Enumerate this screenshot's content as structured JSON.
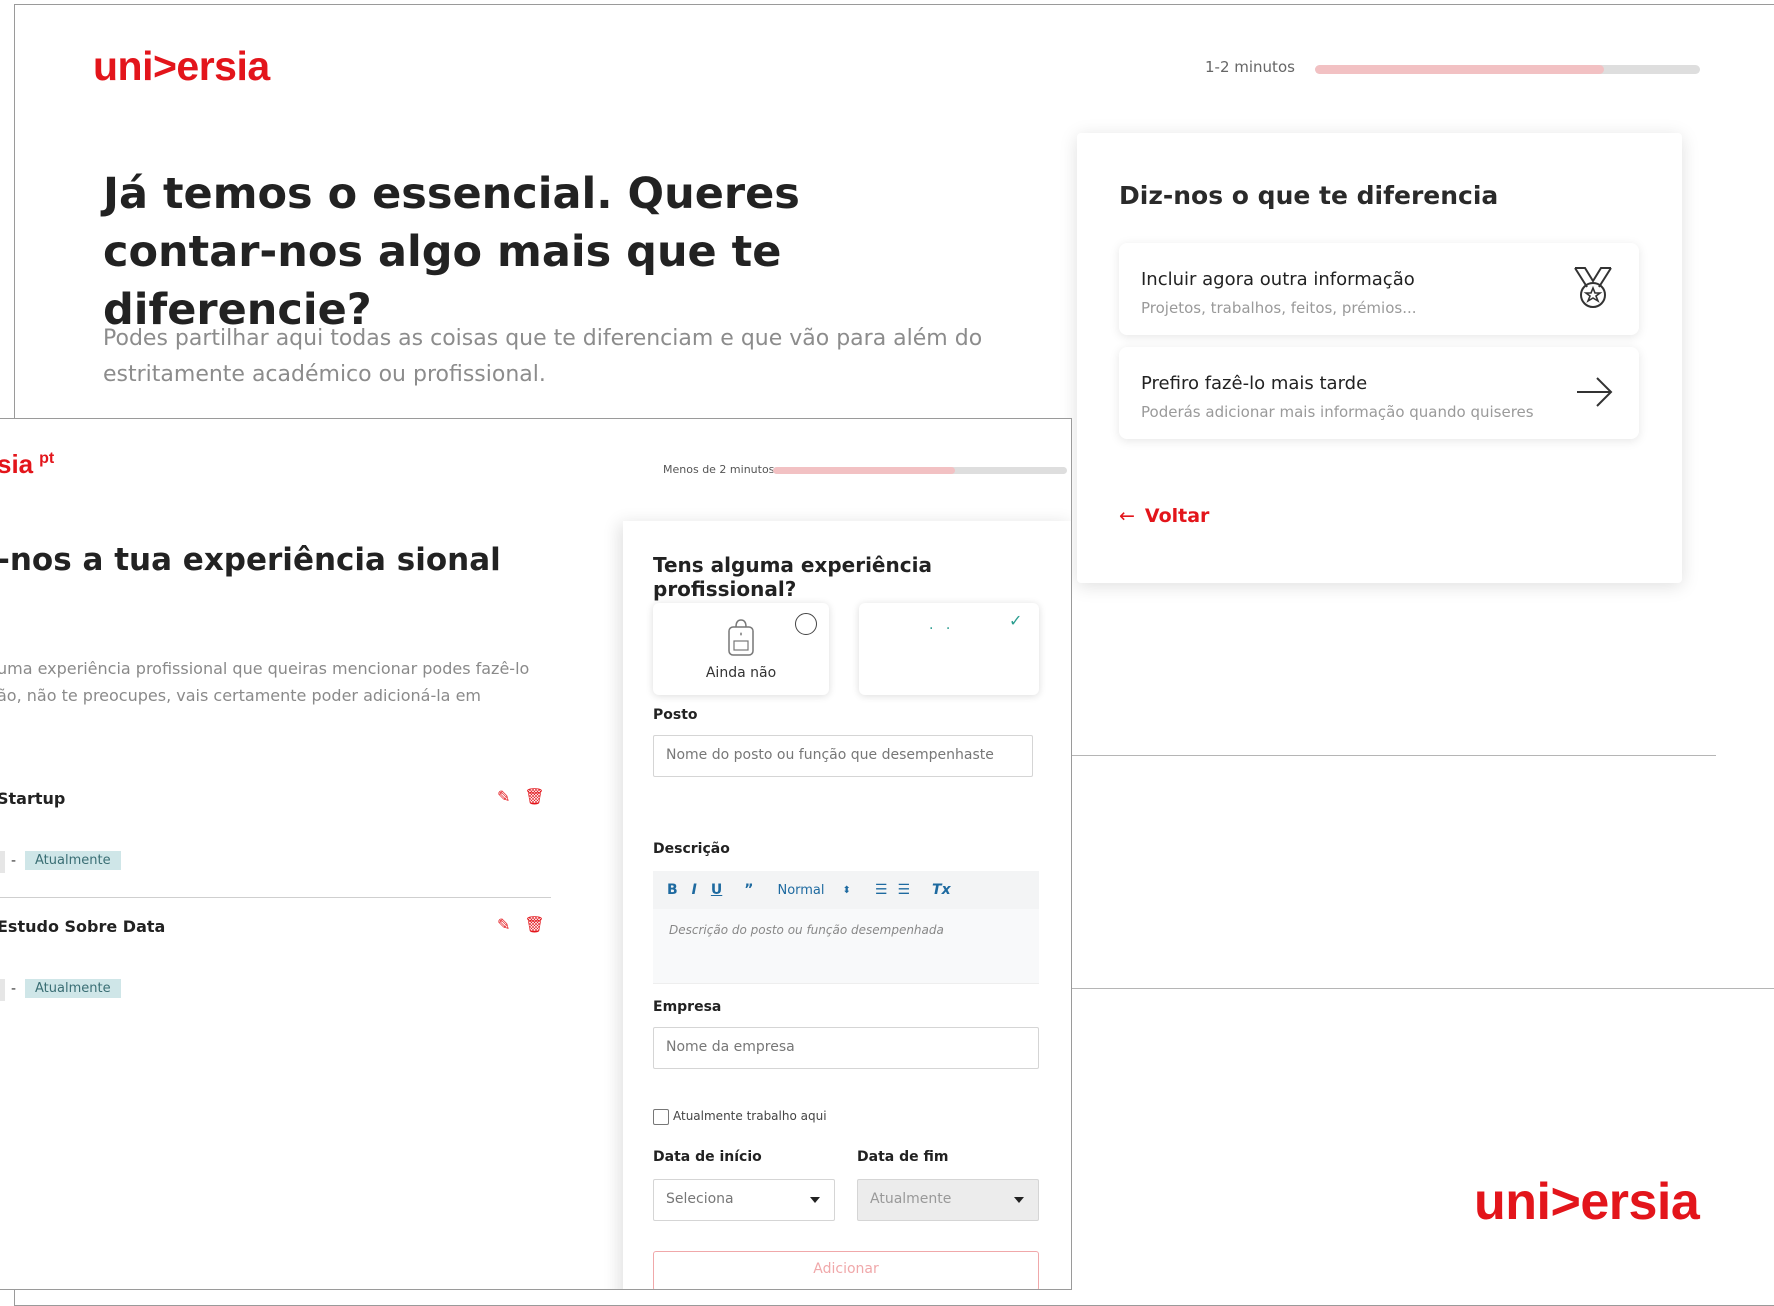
{
  "screen_a": {
    "logo": "uni>ersia",
    "progress": {
      "label": "1-2 minutos",
      "percent": 75
    },
    "title": "Já temos o essencial. Queres contar-nos algo mais que te diferencie?",
    "subtitle": "Podes partilhar aqui todas as coisas que te diferenciam e que vão para além do estritamente académico ou profissional.",
    "card": {
      "title": "Diz-nos o que te diferencia",
      "options": [
        {
          "title": "Incluir agora outra informação",
          "subtitle": "Projetos, trabalhos, feitos, prémios...",
          "icon": "medal-icon"
        },
        {
          "title": "Prefiro fazê-lo mais tarde",
          "subtitle": "Poderás adicionar mais informação quando quiseres",
          "icon": "arrow-right-icon"
        }
      ],
      "back_label": "Voltar"
    }
  },
  "footer_logo": "uni>ersia",
  "screen_b": {
    "logo": "sia",
    "logo_suffix": "pt",
    "progress": {
      "label": "Menos de 2 minutos",
      "percent": 62
    },
    "title": "-nos a tua experiência sional",
    "subtitle": "uma experiência profissional que queiras mencionar podes fazê-lo ão, não te preocupes, vais certamente poder adicioná-la em",
    "experiences": [
      {
        "title": "Startup",
        "dash": "-",
        "tag": "Atualmente"
      },
      {
        "title": "Estudo Sobre Data",
        "dash": "-",
        "tag": "Atualmente"
      }
    ],
    "form": {
      "title": "Tens alguma experiência profissional?",
      "choice_no": "Ainda não",
      "choice_yes_text": "· ·",
      "posto_label": "Posto",
      "posto_placeholder": "Nome do posto ou função que desempenhaste",
      "descricao_label": "Descrição",
      "toolbar": {
        "bold": "B",
        "italic": "I",
        "underline": "U",
        "quote": "”",
        "size": "Normal",
        "clear": "Tx"
      },
      "descricao_placeholder": "Descrição do posto ou função desempenhada",
      "empresa_label": "Empresa",
      "empresa_placeholder": "Nome da empresa",
      "checkbox_label": "Atualmente trabalho aqui",
      "data_inicio_label": "Data de início",
      "data_inicio_value": "Seleciona",
      "data_fim_label": "Data de fim",
      "data_fim_value": "Atualmente",
      "add_button": "Adicionar"
    }
  },
  "colors": {
    "brand_red": "#e3151b",
    "tag_bg": "#cfe6e8",
    "progress_fill": "#f2c1c3"
  }
}
